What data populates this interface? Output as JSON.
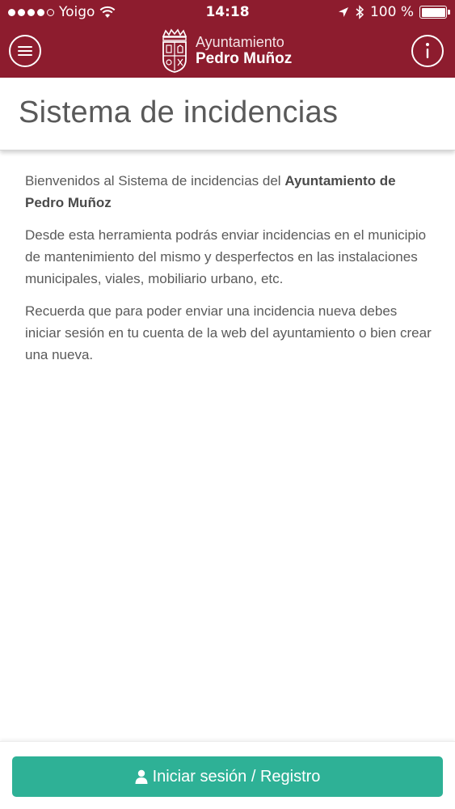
{
  "status_bar": {
    "carrier": "Yoigo",
    "time": "14:18",
    "battery_percent": "100 %",
    "battery_level": 1.0,
    "signal_bars_filled": 4,
    "icons": [
      "wifi-icon",
      "location-arrow-icon",
      "bluetooth-icon",
      "battery-icon"
    ]
  },
  "header": {
    "brand_line1": "Ayuntamiento",
    "brand_line2": "Pedro Muñoz",
    "background_color": "#8d1c2e",
    "icons": [
      "hamburger-menu-icon",
      "coat-of-arms-logo",
      "info-icon"
    ]
  },
  "page": {
    "title": "Sistema de incidencias"
  },
  "content": {
    "intro_prefix": "Bienvenidos al Sistema de incidencias del ",
    "intro_bold": "Ayuntamiento de Pedro Muñoz",
    "paragraph2": "Desde esta herramienta podrás enviar incidencias en el municipio de mantenimiento del mismo y desperfectos en las instalaciones municipales, viales, mobiliario urbano, etc.",
    "paragraph3": "Recuerda que para poder enviar una incidencia nueva debes iniciar sesión en tu cuenta de la web del ayuntamiento o bien crear una nueva."
  },
  "footer": {
    "login_button_label": "Iniciar sesión / Registro",
    "button_color": "#2eb196",
    "icon": "user-icon"
  }
}
